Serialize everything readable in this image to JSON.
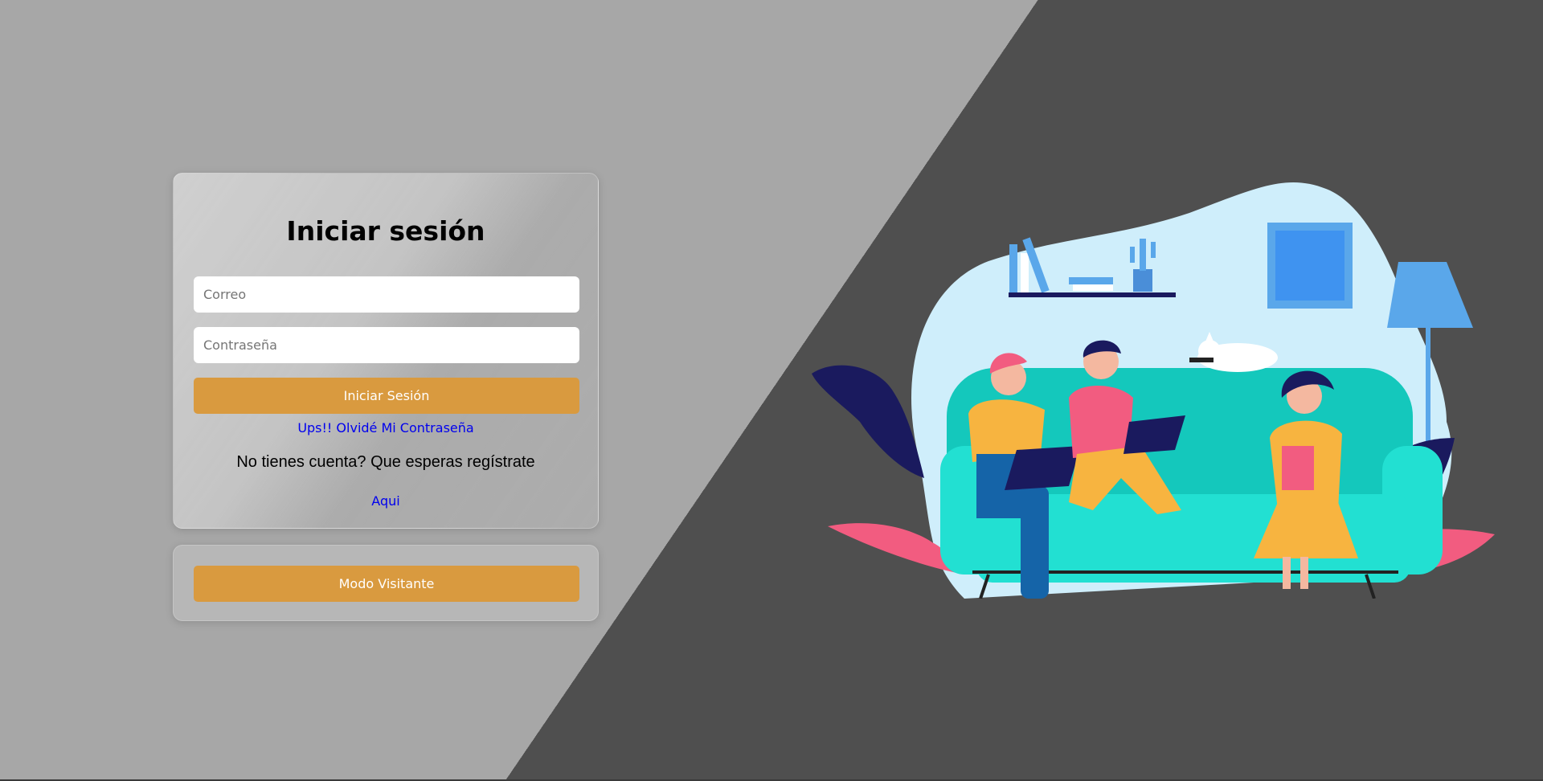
{
  "login": {
    "title": "Iniciar sesión",
    "email_placeholder": "Correo",
    "password_placeholder": "Contraseña",
    "submit_label": "Iniciar Sesión",
    "forgot_label": "Ups!! Olvidé Mi Contraseña",
    "register_text": "No tienes cuenta? Que esperas regístrate",
    "register_link": "Aqui"
  },
  "visitor": {
    "button_label": "Modo Visitante"
  },
  "colors": {
    "accent": "#d99a3f",
    "link": "#0000ee",
    "background_light": "#a7a7a7",
    "background_dark": "#4f4f4f"
  }
}
